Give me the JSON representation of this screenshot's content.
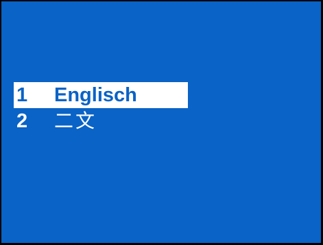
{
  "language_menu": {
    "items": [
      {
        "number": "1",
        "label": "Englisch"
      },
      {
        "number": "2",
        "label": "二文"
      }
    ]
  }
}
